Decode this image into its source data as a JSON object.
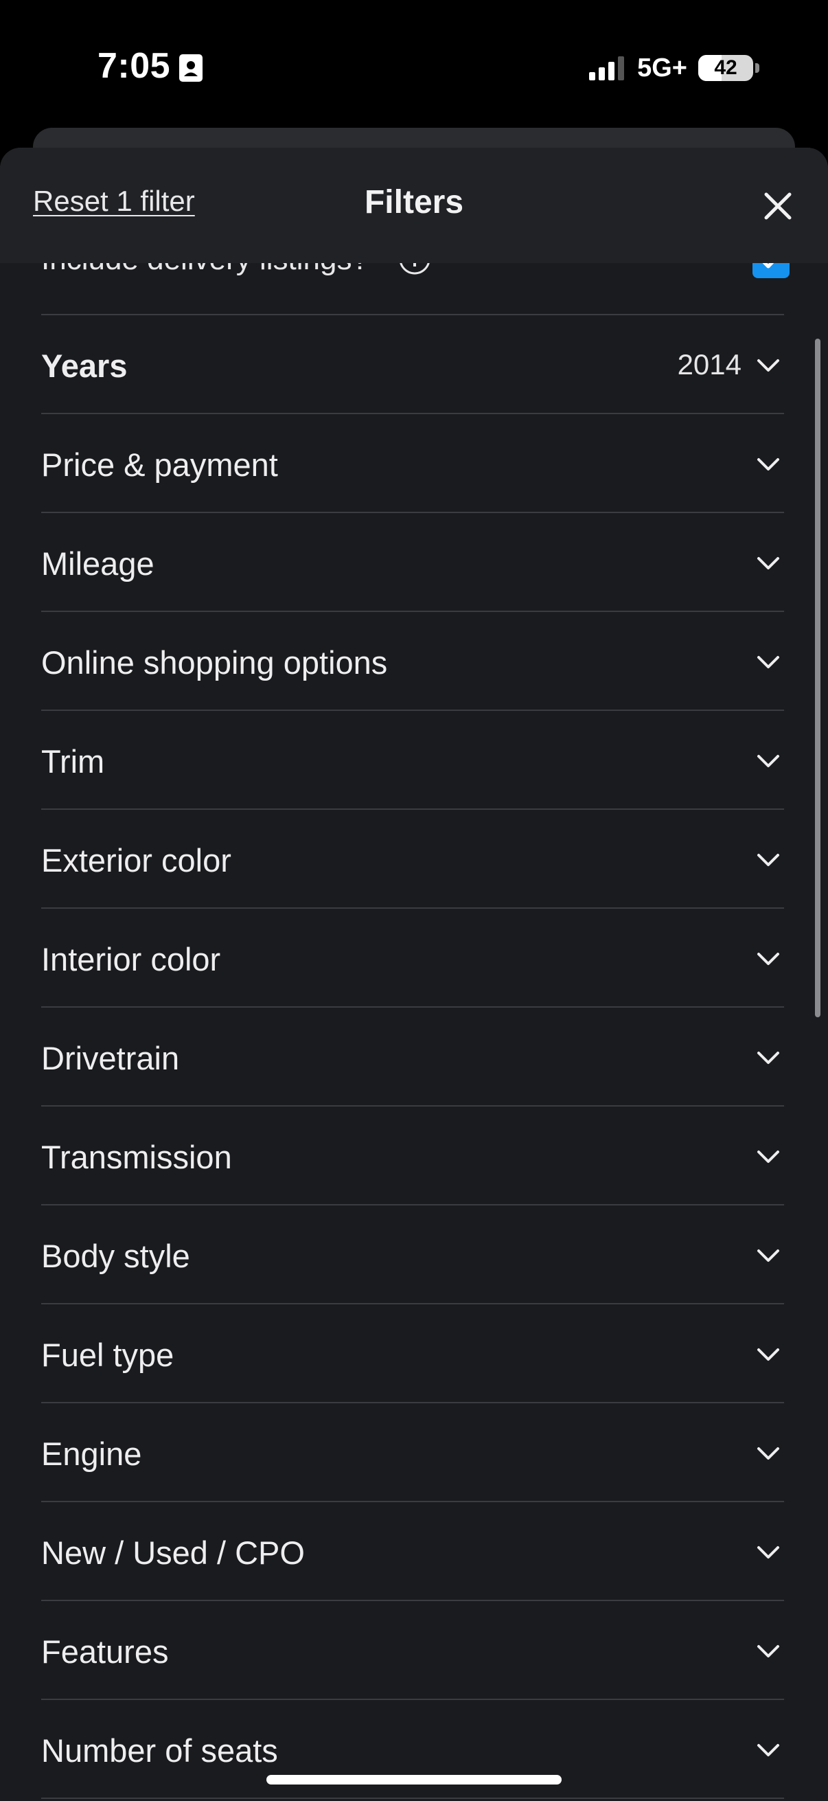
{
  "status_bar": {
    "time": "7:05",
    "network": "5G+",
    "battery": "42",
    "battery_level": 0.42
  },
  "header": {
    "reset_label": "Reset 1 filter",
    "title": "Filters",
    "close_icon": "close-icon"
  },
  "delivery": {
    "label": "Include delivery listings?",
    "info_icon": "info-icon",
    "checked": true
  },
  "filters": [
    {
      "label": "Years",
      "value": "2014",
      "bold": true
    },
    {
      "label": "Price & payment"
    },
    {
      "label": "Mileage"
    },
    {
      "label": "Online shopping options"
    },
    {
      "label": "Trim"
    },
    {
      "label": "Exterior color"
    },
    {
      "label": "Interior color"
    },
    {
      "label": "Drivetrain"
    },
    {
      "label": "Transmission"
    },
    {
      "label": "Body style"
    },
    {
      "label": "Fuel type"
    },
    {
      "label": "Engine"
    },
    {
      "label": "New / Used / CPO"
    },
    {
      "label": "Features"
    },
    {
      "label": "Number of seats"
    }
  ],
  "colors": {
    "background": "#1a1b1e",
    "header": "#202226",
    "accent": "#1592f0"
  }
}
